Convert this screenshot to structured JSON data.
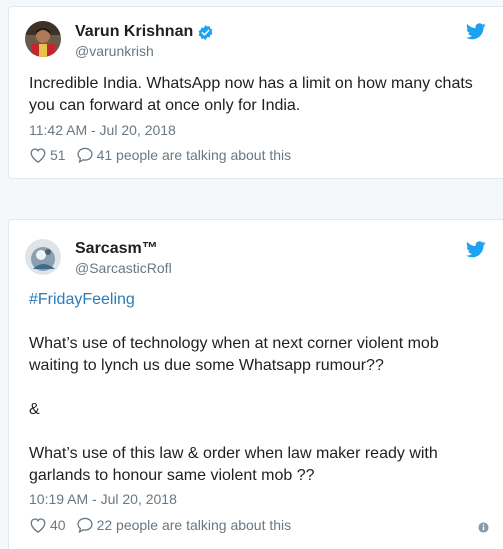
{
  "tweets": [
    {
      "author": "Varun Krishnan",
      "handle": "@varunkrish",
      "verified": true,
      "text_lines": [
        "Incredible India. WhatsApp now has a limit on how many chats",
        "you can forward at once only for India."
      ],
      "timestamp": "11:42 AM - Jul 20, 2018",
      "likes": "51",
      "talking": "41 people are talking about this"
    },
    {
      "author": "Sarcasm™",
      "handle": "@SarcasticRofl",
      "verified": false,
      "hashtag": "#FridayFeeling",
      "text_lines": [
        "What’s use of technology when at next corner violent mob",
        "waiting to lynch us due some Whatsapp rumour??",
        "&",
        "What’s use of this law & order when law maker ready with",
        "garlands to honour same violent mob ??"
      ],
      "timestamp": "10:19 AM - Jul 20, 2018",
      "likes": "40",
      "talking": "22 people are talking about this"
    }
  ],
  "colors": {
    "twitter_blue": "#1da1f2",
    "link": "#2b7bb9",
    "meta": "#697882"
  }
}
